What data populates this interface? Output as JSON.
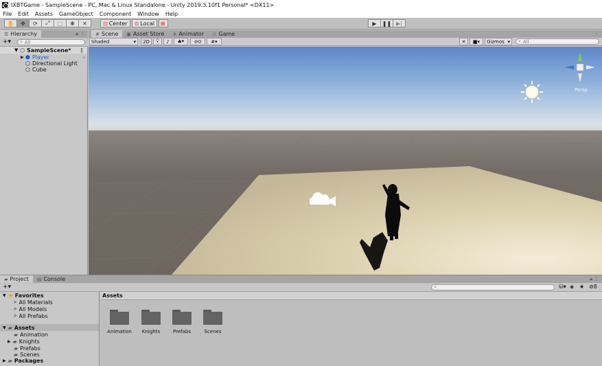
{
  "window": {
    "title": "IXBTGame - SampleScene - PC, Mac & Linux Standalone - Unity 2019.3.10f1 Personal* <DX11>"
  },
  "menu": [
    "File",
    "Edit",
    "Assets",
    "GameObject",
    "Component",
    "Window",
    "Help"
  ],
  "toolbar": {
    "pivot_label": "Center",
    "space_label": "Local"
  },
  "hierarchy": {
    "tab_label": "Hierarchy",
    "search_placeholder": "All",
    "scene_name": "SampleScene*",
    "items": [
      "Player",
      "Directional Light",
      "Cube"
    ]
  },
  "scene_tabs": [
    "Scene",
    "Asset Store",
    "Animator",
    "Game"
  ],
  "scene_bar": {
    "shading": "Shaded",
    "mode_2d": "2D",
    "hidden_count": "0",
    "gizmos": "Gizmos",
    "search_placeholder": "All",
    "persp_label": "Persp"
  },
  "project": {
    "tabs": [
      "Project",
      "Console"
    ],
    "hidden_count": "8",
    "favorites_label": "Favorites",
    "favorites": [
      "All Materials",
      "All Models",
      "All Prefabs"
    ],
    "assets_label": "Assets",
    "asset_tree": [
      "Animation",
      "Knights",
      "Prefabs",
      "Scenes"
    ],
    "packages_label": "Packages",
    "breadcrumb": "Assets",
    "folders": [
      "Animation",
      "Knights",
      "Prefabs",
      "Scenes"
    ]
  },
  "colors": {
    "sky_top": "#5d87c9",
    "horizon": "#d7e0e6",
    "ground": "#726b65",
    "plane": "#d8cda9",
    "selection": "#1a5fc4"
  }
}
